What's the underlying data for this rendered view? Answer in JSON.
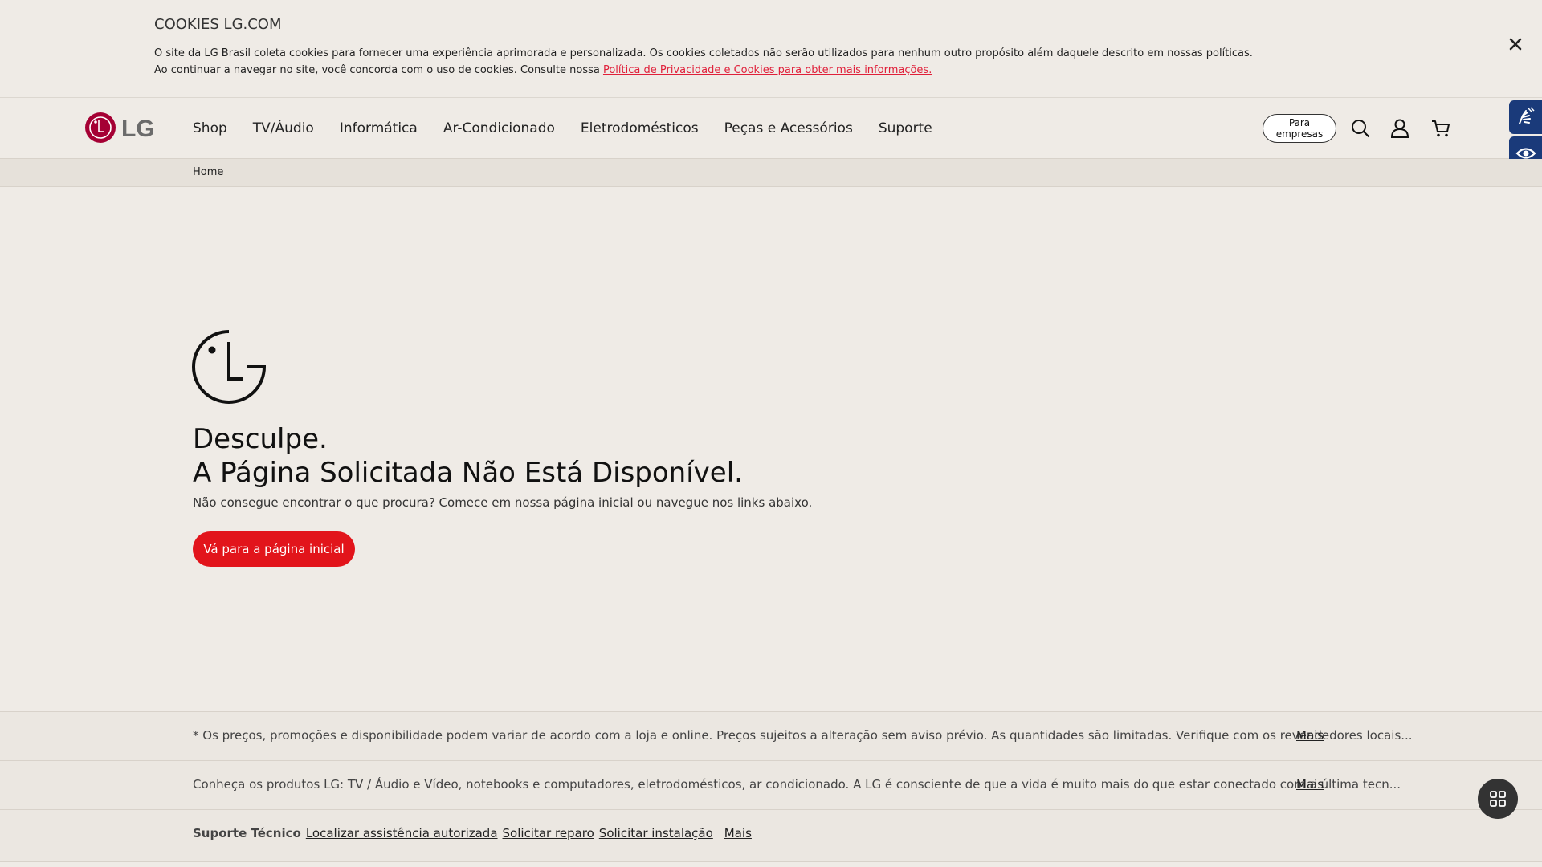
{
  "cookie": {
    "title": "COOKIES LG.COM",
    "line1": "O site da LG Brasil coleta cookies para fornecer uma experiência aprimorada e personalizada. Os cookies coletados não serão utilizados para nenhum outro propósito além daquele descrito em nossas políticas.",
    "line2": "Ao continuar a navegar no site, você concorda com o uso de cookies. Consulte nossa ",
    "link": "Política de Privacidade e Cookies para obter mais informações.",
    "close_icon": "close-icon"
  },
  "header": {
    "logo_text": "LG",
    "nav": [
      "Shop",
      "TV/Áudio",
      "Informática",
      "Ar-Condicionado",
      "Eletrodomésticos",
      "Peças e Acessórios",
      "Suporte"
    ],
    "business_button_line1": "Para",
    "business_button_line2": "empresas",
    "icons": [
      "search-icon",
      "user-icon",
      "cart-icon"
    ]
  },
  "accessibility": {
    "icons": [
      "sign-language-icon",
      "eye-icon"
    ],
    "accent": "#1a3a7a"
  },
  "breadcrumb": {
    "home": "Home"
  },
  "main": {
    "title_line1": "Desculpe.",
    "title_line2": "A Página Solicitada Não Está Disponível.",
    "subtitle": "Não consegue encontrar o que procura? Comece em nossa página inicial ou navegue nos links abaixo.",
    "button": "Vá para a página inicial",
    "button_color": "#e2141b"
  },
  "footer": {
    "disclaimer": "* Os preços, promoções e disponibilidade podem variar de acordo com a loja e online. Preços sujeitos a alteração sem aviso prévio. As quantidades são limitadas. Verifique com os revendedores locais...",
    "about": "Conheça os produtos LG: TV / Áudio e Vídeo, notebooks e computadores, eletrodomésticos, ar condicionado. A LG é consciente de que a vida é muito mais do que estar conectado com a última tecn...",
    "more": "Mais",
    "support_label": "Suporte Técnico",
    "support_links": [
      "Localizar assistência autorizada",
      "Solicitar reparo",
      "Solicitar instalação"
    ]
  },
  "fab_icon": "grid-icon"
}
